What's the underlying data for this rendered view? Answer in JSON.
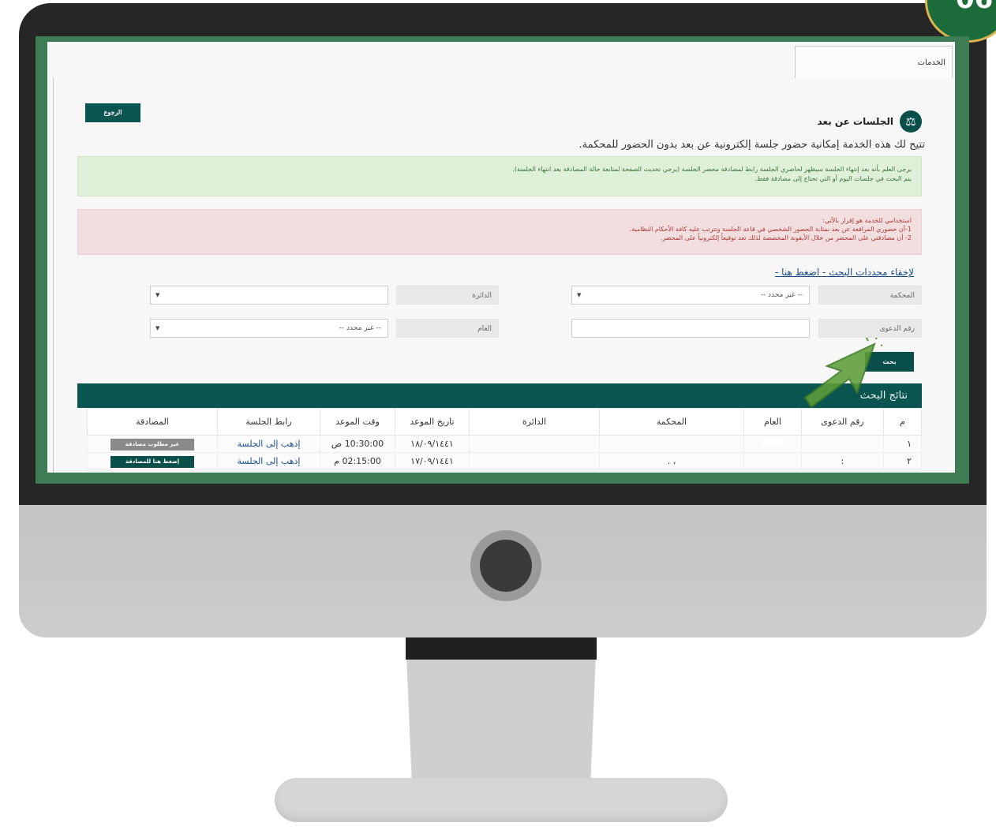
{
  "badge": {
    "text": "06"
  },
  "tabs": {
    "services": "الخدمات"
  },
  "back_label": "الرجوع",
  "title": "الجلسات عن بعد",
  "subtitle": "تتيح لك هذه الخدمة إمكانية حضور جلسة إلكترونية عن بعد بدون الحضور للمحكمة.",
  "info_alert": {
    "line1": "يرجى العلم بأنه بعد إنتهاء الجلسة سيظهر لحاضري الجلسة رابط لمصادقة محضر الجلسة (يرجي تحديث الصفحة لمتابعة حالة المصادقة بعد انتهاء الجلسة).",
    "line2": "يتم البحث في جلسات اليوم أو التي تحتاج إلى مصادقة فقط."
  },
  "warning_alert": {
    "line1": "استخدامي للخدمة هو إقرار بالآتي:",
    "line2": "1-أن حضوري المرافعة عن بعد بمثابة الحضور الشخصي في قاعة الجلسة وتترتب عليه كافة الأحكام النظامية.",
    "line3": "2- أن مصادقتي على المحضر من خلال الأيقونة المخصصة لذلك تعد توقيعاً إلكترونياً على المحضر."
  },
  "hide_filters_link": "لإخفاء محددات البحث - اضغط هنا -",
  "filters": {
    "court_label": "المحكمة",
    "court_value": "-- غير محدد --",
    "circuit_label": "الدائرة",
    "circuit_value": "",
    "case_number_label": "رقم الدعوى",
    "case_number_value": "",
    "year_label": "العام",
    "year_value": "-- غير محدد --"
  },
  "search_button": "بحث",
  "results_title": "نتائج البحث",
  "table": {
    "headers": [
      "م",
      "رقم الدعوى",
      "العام",
      "المحكمة",
      "الدائرة",
      "تاريخ الموعد",
      "وقت الموعد",
      "رابط الجلسة",
      "المصادقة"
    ],
    "rows": [
      {
        "index": "١",
        "case_number": "",
        "year": "",
        "court": "",
        "circuit": "",
        "date": "١٨/٠٩/١٤٤١",
        "time": "10:30:00 ص",
        "link": "إذهب إلى الجلسة",
        "approval": "غير مطلوب مصادقة"
      },
      {
        "index": "٢",
        "case_number": ":",
        "year": "",
        "court": "، .",
        "circuit": "",
        "date": "١٧/٠٩/١٤٤١",
        "time": "02:15:00 م",
        "link": "إذهب إلى الجلسة",
        "approval": "إضغط هنا للمصادقة"
      }
    ]
  },
  "colors": {
    "brand_green": "#0b5550",
    "frame_green": "#3e7c55",
    "arrow": "#5e9e3a"
  }
}
